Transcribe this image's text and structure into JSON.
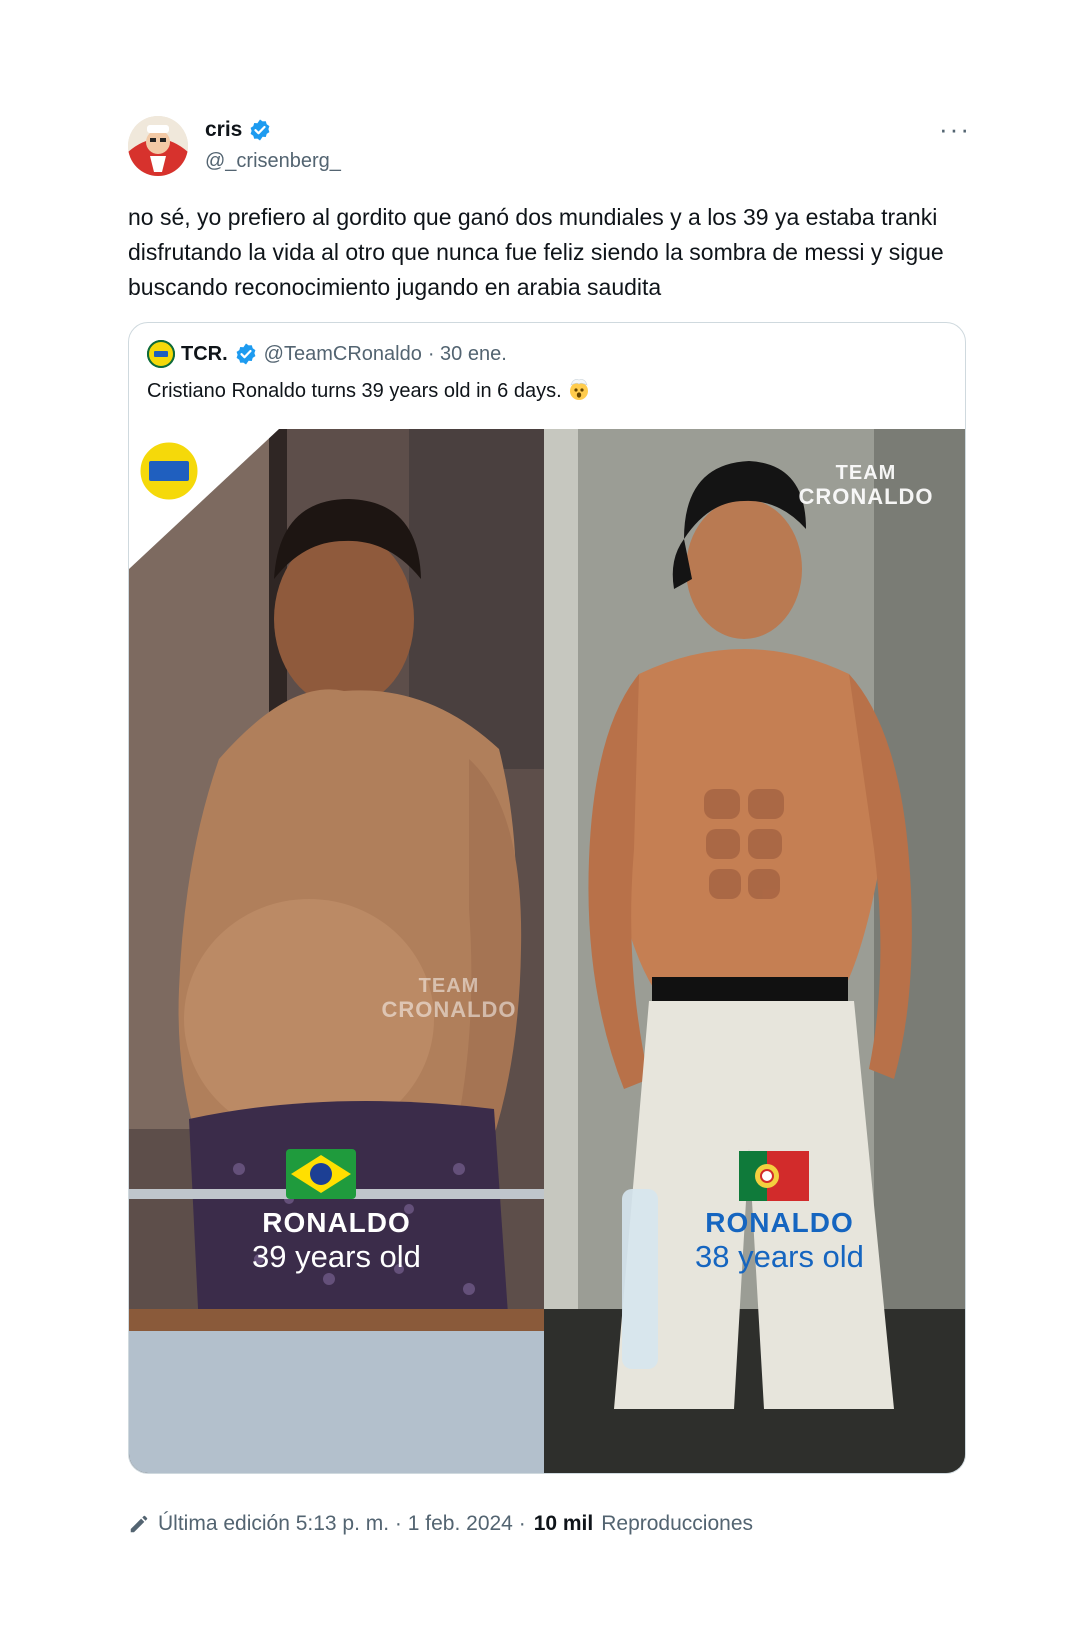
{
  "author": {
    "name": "cris",
    "handle": "@_crisenberg_"
  },
  "tweet_text": "no sé, yo prefiero al gordito que ganó dos mundiales y a los 39 ya estaba tranki disfrutando la vida al otro que nunca fue feliz siendo la sombra de messi y sigue buscando reconocimiento jugando en arabia saudita",
  "quote": {
    "name": "TCR.",
    "handle": "@TeamCRonaldo",
    "date": "· 30 ene.",
    "text": "Cristiano Ronaldo turns 39 years old in 6 days.",
    "logo_text": "TCR",
    "watermark_line1": "TEAM",
    "watermark_line2": "CRONALDO",
    "left": {
      "name": "RONALDO",
      "age": "39 years old",
      "flag": "brazil-flag"
    },
    "right": {
      "name": "RONALDO",
      "age": "38 years old",
      "flag": "portugal-flag",
      "accent": "#1565c0"
    }
  },
  "footer": {
    "edited": "Última edición 5:13 p. m. · 1 feb. 2024 ·",
    "views_count": "10 mil",
    "views_label": "Reproducciones"
  },
  "colors": {
    "verified": "#1d9bf0",
    "secondary_text": "#536471",
    "border": "#cfd9de"
  }
}
